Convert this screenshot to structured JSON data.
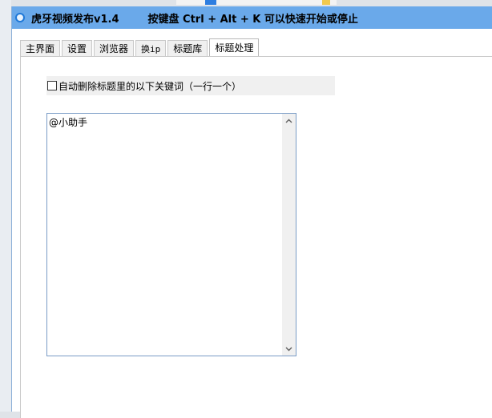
{
  "window": {
    "title": "虎牙视频发布v1.4",
    "hotkey_hint": "按键盘 Ctrl + Alt + K 可以快速开始或停止"
  },
  "tabs": [
    {
      "label": "主界面"
    },
    {
      "label": "设置"
    },
    {
      "label": "浏览器"
    },
    {
      "label": "换ip"
    },
    {
      "label": "标题库"
    },
    {
      "label": "标题处理"
    }
  ],
  "active_tab": "标题处理",
  "title_processing": {
    "auto_delete_checkbox_label": "自动删除标题里的以下关键词（一行一个）",
    "auto_delete_checked": false,
    "keywords_text": "@小助手"
  },
  "icons": {
    "app": "app-logo-icon",
    "scroll_up": "chevron-up-icon",
    "scroll_down": "chevron-down-icon"
  },
  "colors": {
    "titlebar": "#6aa9ea",
    "textarea_border": "#7a9cc6"
  }
}
